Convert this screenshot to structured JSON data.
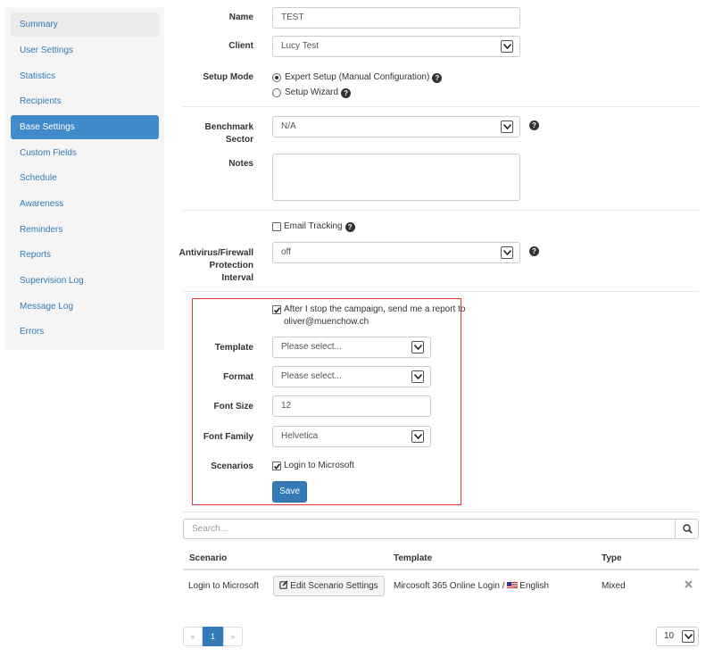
{
  "sidebar": {
    "items": [
      {
        "label": "Summary"
      },
      {
        "label": "User Settings"
      },
      {
        "label": "Statistics"
      },
      {
        "label": "Recipients"
      },
      {
        "label": "Base Settings"
      },
      {
        "label": "Custom Fields"
      },
      {
        "label": "Schedule"
      },
      {
        "label": "Awareness"
      },
      {
        "label": "Reminders"
      },
      {
        "label": "Reports"
      },
      {
        "label": "Supervision Log"
      },
      {
        "label": "Message Log"
      },
      {
        "label": "Errors"
      }
    ],
    "active_index": 4
  },
  "form": {
    "name_label": "Name",
    "name_value": "TEST",
    "client_label": "Client",
    "client_value": "Lucy Test",
    "setup_mode_label": "Setup Mode",
    "setup_expert": "Expert Setup (Manual Configuration)",
    "setup_wizard": "Setup Wizard",
    "benchmark_label_1": "Benchmark",
    "benchmark_label_2": "Sector",
    "benchmark_value": "N/A",
    "notes_label": "Notes",
    "notes_value": "",
    "email_tracking": "Email Tracking",
    "antivirus_label_1": "Antivirus/Firewall",
    "antivirus_label_2": "Protection",
    "antivirus_label_3": "Interval",
    "antivirus_value": "off"
  },
  "report": {
    "stop_report_line1": "After I stop the campaign, send me a report to",
    "stop_report_line2": "oliver@muenchow.ch",
    "template_label": "Template",
    "template_value": "Please select...",
    "format_label": "Format",
    "format_value": "Please select...",
    "font_size_label": "Font Size",
    "font_size_value": "12",
    "font_family_label": "Font Family",
    "font_family_value": "Helvetica",
    "scenarios_label": "Scenarios",
    "scenario_option": "Login to Microsoft",
    "save_label": "Save"
  },
  "search": {
    "placeholder": "Search..."
  },
  "table": {
    "headers": [
      "Scenario",
      "Template",
      "Type"
    ],
    "rows": [
      {
        "scenario": "Login to Microsoft",
        "edit_button": "Edit Scenario Settings",
        "template": "Mircosoft 365 Online Login / ",
        "language": "English",
        "type": "Mixed"
      }
    ]
  },
  "pagination": {
    "prev": "«",
    "current": "1",
    "next": "»",
    "page_size": "10"
  }
}
